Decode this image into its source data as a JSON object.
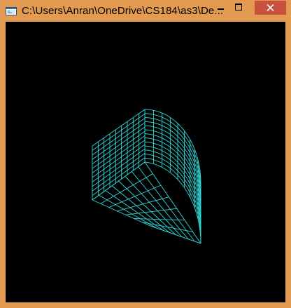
{
  "window": {
    "title": "C:\\Users\\Anran\\OneDrive\\CS184\\as3\\De...",
    "frame_color": "#e39a51",
    "close_color": "#c7503f",
    "icons": {
      "app": "console-window-icon",
      "minimize": "minimize-icon",
      "maximize": "maximize-icon",
      "close": "close-icon"
    }
  },
  "viewport": {
    "background": "#000000",
    "wire_color": "#2fd6d6"
  }
}
